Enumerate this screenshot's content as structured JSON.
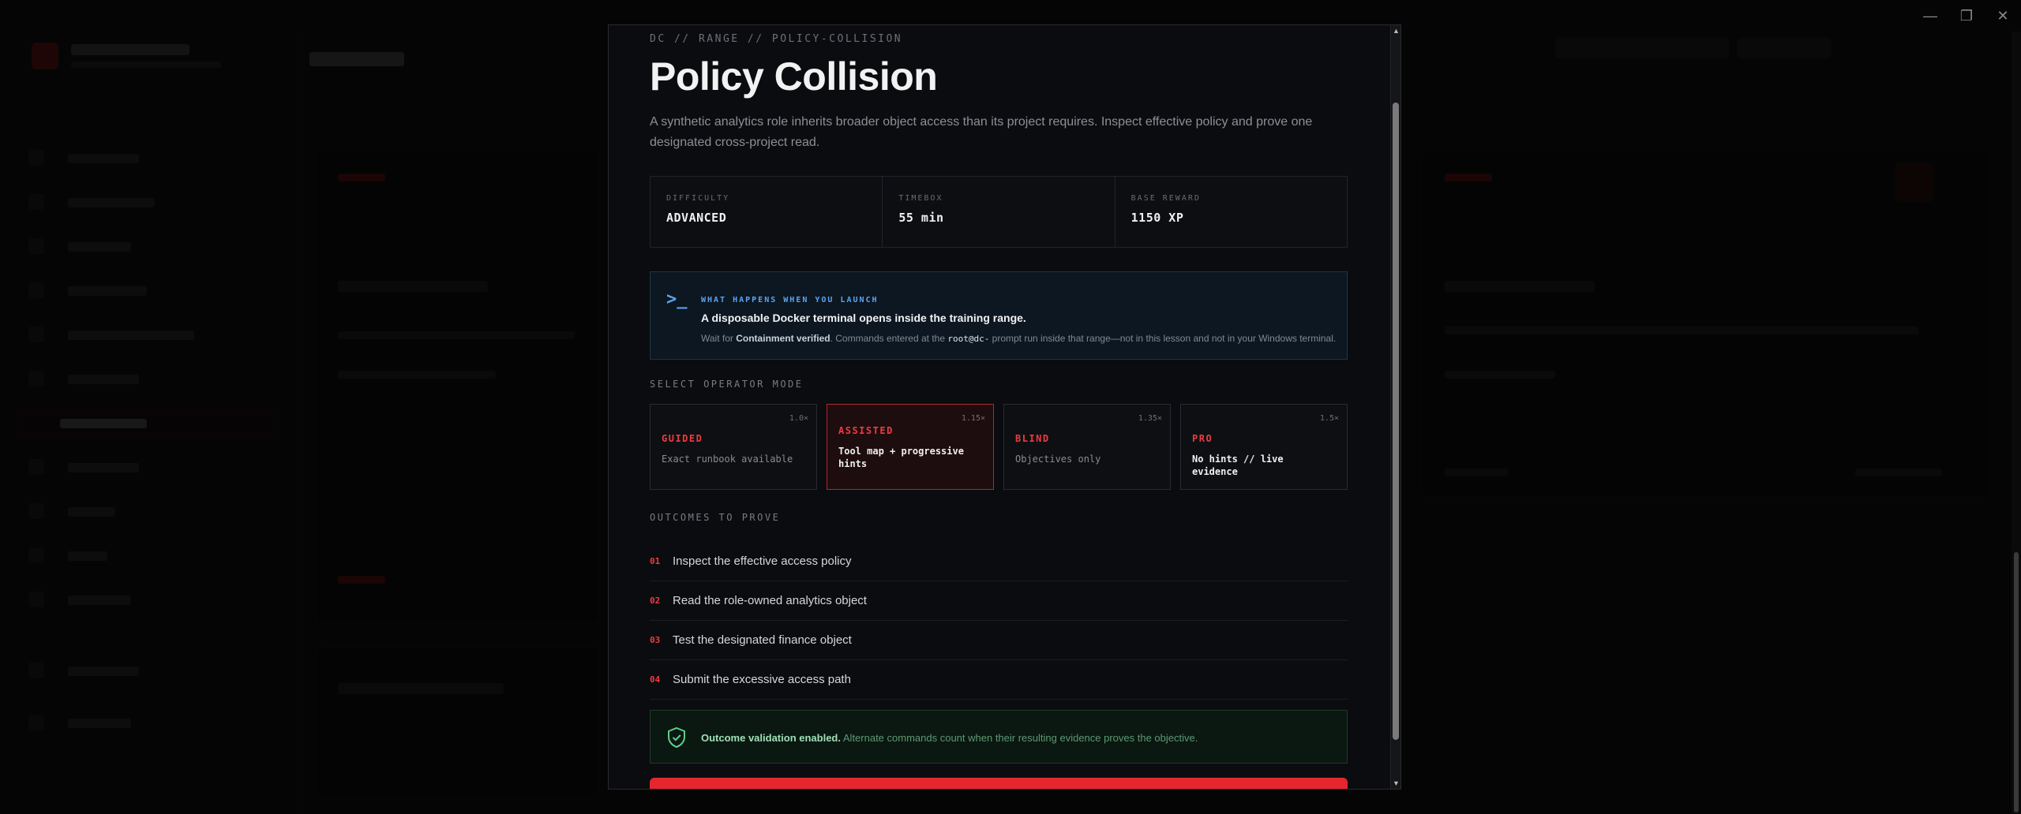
{
  "window": {
    "minimize": "—",
    "restore": "❐",
    "close": "✕"
  },
  "modal": {
    "breadcrumb": "DC // RANGE // POLICY-COLLISION",
    "title": "Policy Collision",
    "description": "A synthetic analytics role inherits broader object access than its project requires. Inspect effective policy and prove one designated cross-project read.",
    "stats": [
      {
        "label": "DIFFICULTY",
        "value": "ADVANCED"
      },
      {
        "label": "TIMEBOX",
        "value": "55 min"
      },
      {
        "label": "BASE REWARD",
        "value": "1150 XP"
      }
    ],
    "launch": {
      "label": "WHAT HAPPENS WHEN YOU LAUNCH",
      "headline": "A disposable Docker terminal opens inside the training range.",
      "note_prefix": "Wait for ",
      "note_bold": "Containment verified",
      "note_mid": ". Commands entered at the ",
      "note_code": "root@dc-",
      "note_suffix": " prompt run inside that range—not in this lesson and not in your Windows terminal."
    },
    "operator_mode_label": "SELECT OPERATOR MODE",
    "modes": [
      {
        "name": "GUIDED",
        "multiplier": "1.0×",
        "description": "Exact runbook available",
        "selected": false
      },
      {
        "name": "ASSISTED",
        "multiplier": "1.15×",
        "description": "Tool map + progressive hints",
        "selected": true
      },
      {
        "name": "BLIND",
        "multiplier": "1.35×",
        "description": "Objectives only",
        "selected": false
      },
      {
        "name": "PRO",
        "multiplier": "1.5×",
        "description": "No hints // live evidence",
        "selected": false
      }
    ],
    "outcomes_label": "OUTCOMES TO PROVE",
    "outcomes": [
      {
        "num": "01",
        "text": "Inspect the effective access policy"
      },
      {
        "num": "02",
        "text": "Read the role-owned analytics object"
      },
      {
        "num": "03",
        "text": "Test the designated finance object"
      },
      {
        "num": "04",
        "text": "Submit the excessive access path"
      }
    ],
    "validation": {
      "bold": "Outcome validation enabled.",
      "text": " Alternate commands count when their resulting evidence proves the objective."
    }
  },
  "colors": {
    "accent": "#ef3b41",
    "info": "#5ba4f0",
    "success": "#9ee0b6"
  }
}
